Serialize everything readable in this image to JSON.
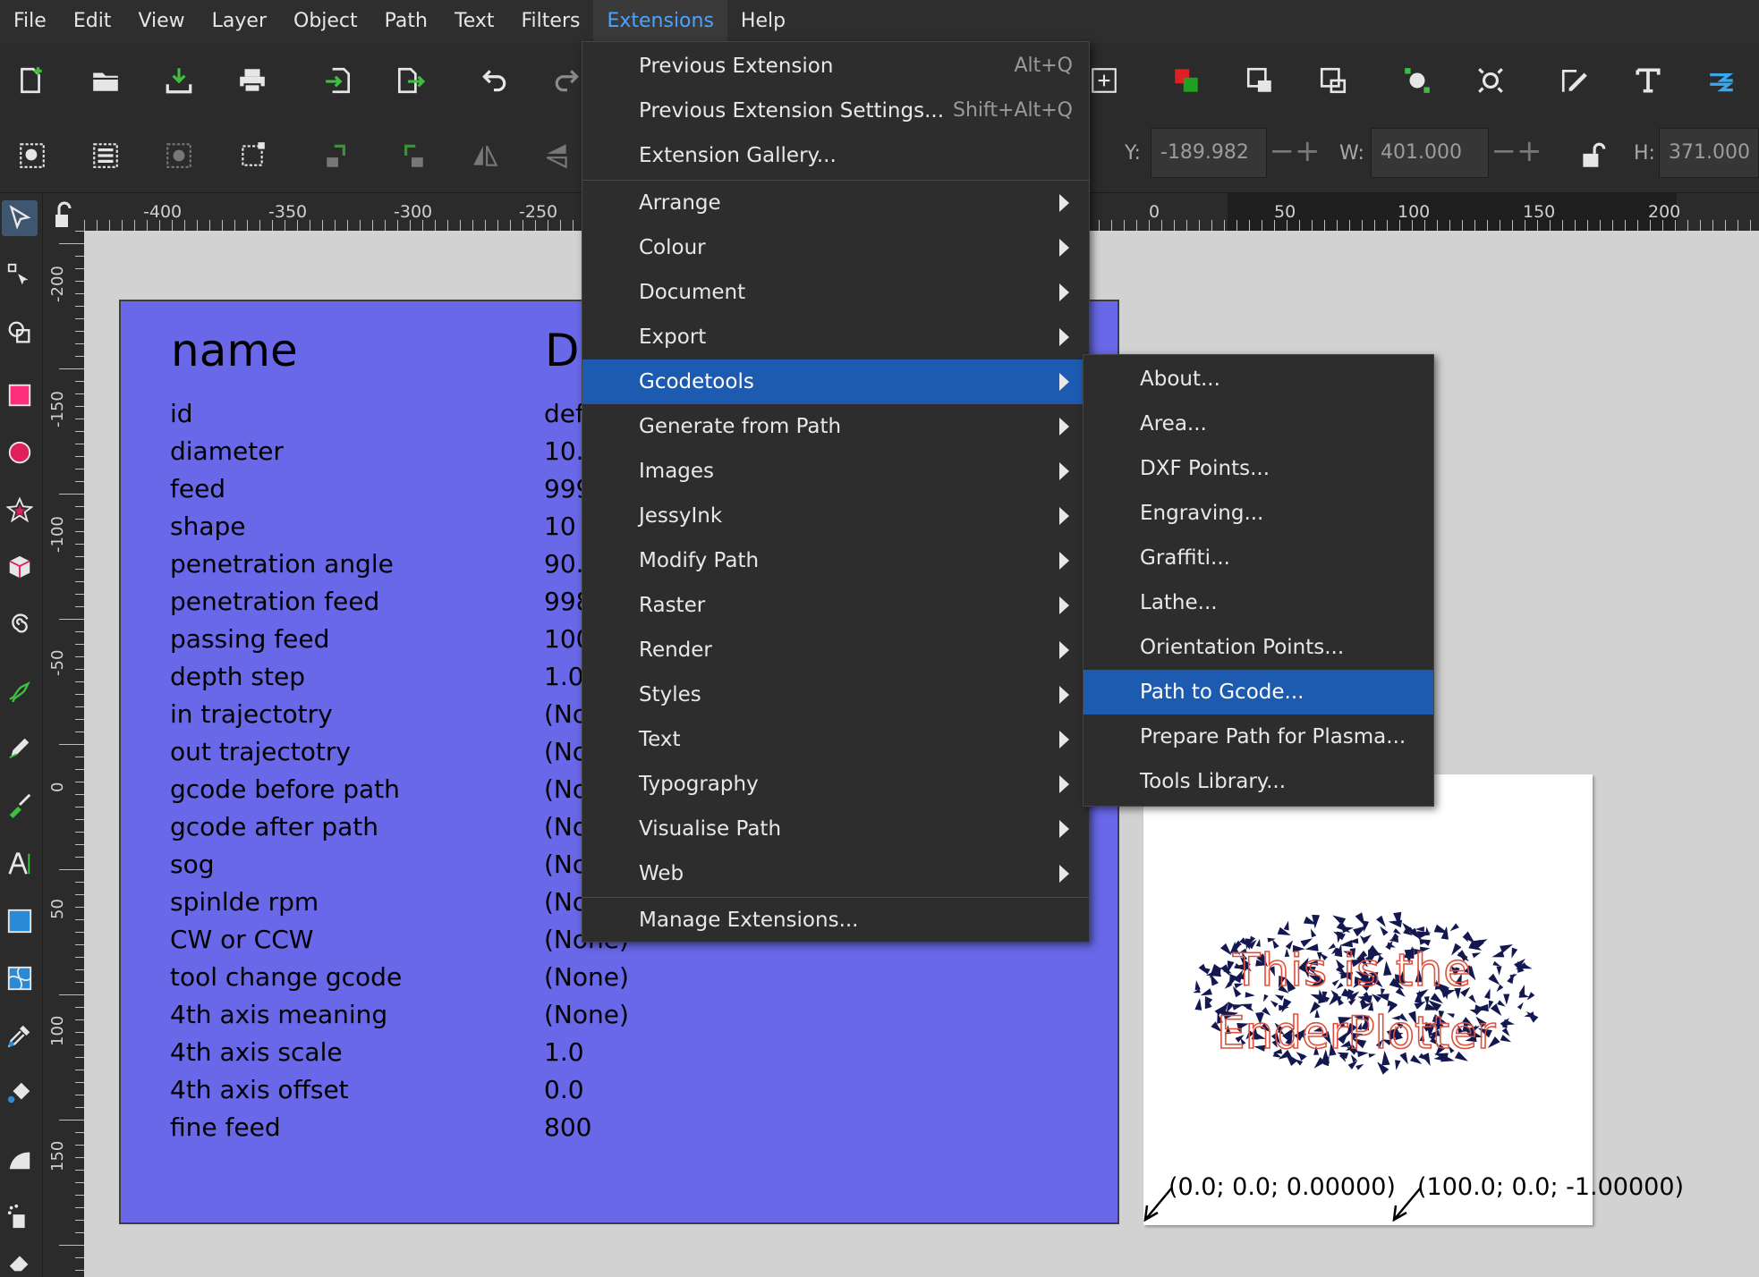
{
  "menubar": {
    "items": [
      "File",
      "Edit",
      "View",
      "Layer",
      "Object",
      "Path",
      "Text",
      "Filters",
      "Extensions",
      "Help"
    ],
    "active": "Extensions"
  },
  "toolbar2": {
    "y_label": "Y:",
    "y_value": "-189.982",
    "w_label": "W:",
    "w_value": "401.000",
    "h_label": "H:",
    "h_value": "371.000",
    "minus": "−",
    "plus": "+"
  },
  "ruler_h": {
    "labels": [
      "-400",
      "-350",
      "-300",
      "-250",
      "0",
      "50",
      "100",
      "150",
      "200"
    ]
  },
  "ruler_v": {
    "labels": [
      "-200",
      "-150",
      "-100",
      "-50",
      "0",
      "50",
      "100",
      "150"
    ]
  },
  "extensions_menu": {
    "items": [
      {
        "label": "Previous Extension",
        "shortcut": "Alt+Q"
      },
      {
        "label": "Previous Extension Settings...",
        "shortcut": "Shift+Alt+Q"
      },
      {
        "label": "Extension Gallery..."
      },
      {
        "label": "Arrange",
        "submenu": true
      },
      {
        "label": "Colour",
        "submenu": true
      },
      {
        "label": "Document",
        "submenu": true
      },
      {
        "label": "Export",
        "submenu": true
      },
      {
        "label": "Gcodetools",
        "submenu": true,
        "highlighted": true
      },
      {
        "label": "Generate from Path",
        "submenu": true
      },
      {
        "label": "Images",
        "submenu": true
      },
      {
        "label": "JessyInk",
        "submenu": true
      },
      {
        "label": "Modify Path",
        "submenu": true
      },
      {
        "label": "Raster",
        "submenu": true
      },
      {
        "label": "Render",
        "submenu": true
      },
      {
        "label": "Styles",
        "submenu": true
      },
      {
        "label": "Text",
        "submenu": true
      },
      {
        "label": "Typography",
        "submenu": true
      },
      {
        "label": "Visualise Path",
        "submenu": true
      },
      {
        "label": "Web",
        "submenu": true
      },
      {
        "label": "Manage Extensions..."
      }
    ]
  },
  "gcodetools_submenu": {
    "items": [
      {
        "label": "About..."
      },
      {
        "label": "Area..."
      },
      {
        "label": "DXF Points..."
      },
      {
        "label": "Engraving..."
      },
      {
        "label": "Graffiti..."
      },
      {
        "label": "Lathe..."
      },
      {
        "label": "Orientation Points..."
      },
      {
        "label": "Path to Gcode...",
        "highlighted": true
      },
      {
        "label": "Prepare Path for Plasma..."
      },
      {
        "label": "Tools Library..."
      }
    ]
  },
  "tool_table": {
    "header_name": "name",
    "header_value": "D",
    "rows": [
      {
        "name": "id",
        "value": "def"
      },
      {
        "name": "diameter",
        "value": "10."
      },
      {
        "name": "feed",
        "value": "999"
      },
      {
        "name": "shape",
        "value": "10"
      },
      {
        "name": "penetration angle",
        "value": "90."
      },
      {
        "name": "penetration feed",
        "value": "998"
      },
      {
        "name": "passing feed",
        "value": "100"
      },
      {
        "name": "depth step",
        "value": "1.0"
      },
      {
        "name": "in trajectotry",
        "value": "(No"
      },
      {
        "name": "out trajectotry",
        "value": "(No"
      },
      {
        "name": "gcode before path",
        "value": "(No"
      },
      {
        "name": "gcode after path",
        "value": "(No"
      },
      {
        "name": "sog",
        "value": "(No"
      },
      {
        "name": "spinlde rpm",
        "value": "(No"
      },
      {
        "name": "CW or CCW",
        "value": "(None)"
      },
      {
        "name": "tool change gcode",
        "value": "(None)"
      },
      {
        "name": "4th axis meaning",
        "value": "(None)"
      },
      {
        "name": "4th axis scale",
        "value": "1.0"
      },
      {
        "name": "4th axis offset",
        "value": "0.0"
      },
      {
        "name": "fine feed",
        "value": "800"
      }
    ]
  },
  "page2": {
    "line1": "This is the",
    "line2": "EnderPlotter",
    "coord1": "(0.0; 0.0; 0.00000)",
    "coord2": "(100.0; 0.0; -1.00000)"
  },
  "colors": {
    "table_fill": "#6868e8",
    "menu_bg": "#2d2d2d",
    "menu_highlight": "#1d5bb0",
    "accent": "#4aa3ff",
    "glyph_fill": "#141850",
    "text_outline": "#e0503c"
  }
}
